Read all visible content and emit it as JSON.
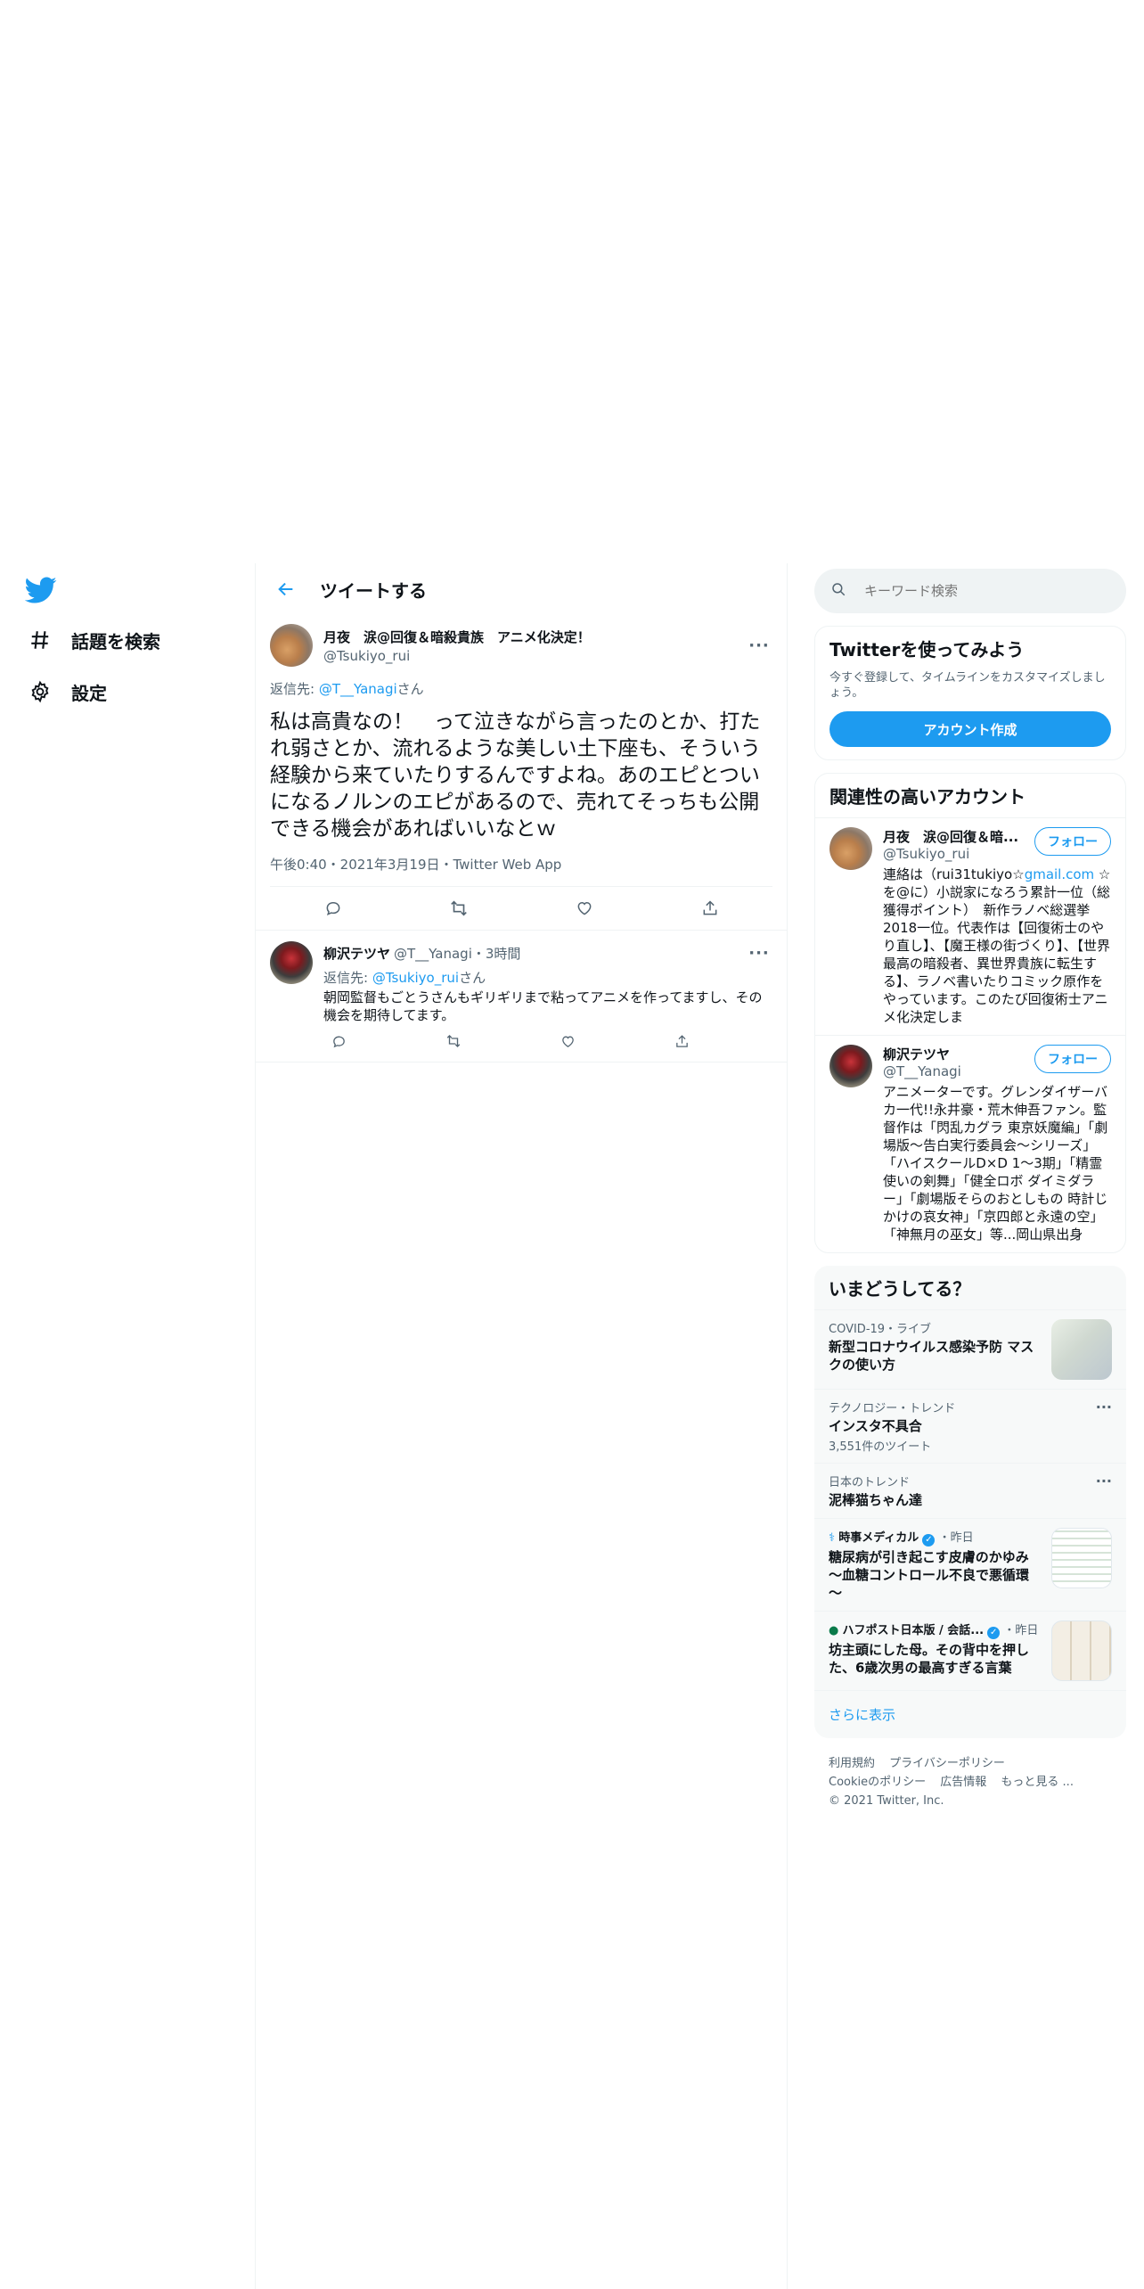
{
  "nav": {
    "logo": "twitter-bird-icon",
    "items": [
      {
        "label": "話題を検索",
        "icon": "hashtag-icon"
      },
      {
        "label": "設定",
        "icon": "gear-icon"
      }
    ]
  },
  "main": {
    "title": "ツイートする",
    "tweet": {
      "name": "月夜　涙@回復＆暗殺貴族　アニメ化決定！",
      "handle": "@Tsukiyo_rui",
      "reply_prefix": "返信先: ",
      "reply_target": "@T__Yanagi",
      "reply_suffix": "さん",
      "text": "私は高貴なの！　って泣きながら言ったのとか、打たれ弱さとか、流れるような美しい土下座も、そういう経験から来ていたりするんですよね。あのエピとついになるノルンのエピがあるので、売れてそっちも公開できる機会があればいいなとｗ",
      "meta": "午後0:40・2021年3月19日・Twitter Web App"
    },
    "reply": {
      "name": "柳沢テツヤ",
      "handle_time": "@T__Yanagi・3時間",
      "reply_prefix": "返信先: ",
      "reply_target": "@Tsukiyo_rui",
      "reply_suffix": "さん",
      "text": "朝岡監督もごとうさんもギリギリまで粘ってアニメを作ってますし、その機会を期待してます。"
    }
  },
  "sidebar": {
    "search_placeholder": "キーワード検索",
    "signup": {
      "title": "Twitterを使ってみよう",
      "desc": "今すぐ登録して、タイムラインをカスタマイズしましょう。",
      "button": "アカウント作成"
    },
    "relevant": {
      "title": "関連性の高いアカウント",
      "follow_label": "フォロー",
      "accounts": [
        {
          "name": "月夜　涙@回復＆暗...",
          "handle": "@Tsukiyo_rui",
          "bio_pre": "連絡は（rui31tukiyo☆",
          "bio_link": "gmail.com",
          "bio_post": " ☆を@に）小説家になろう累計一位（総獲得ポイント）　新作ラノベ総選挙2018一位。代表作は【回復術士のやり直し】、【魔王様の街づくり】、【世界最高の暗殺者、異世界貴族に転生する】、ラノベ書いたりコミック原作をやっています。このたび回復術士アニメ化決定しま"
        },
        {
          "name": "柳沢テツヤ",
          "handle": "@T__Yanagi",
          "bio": "アニメーターです。グレンダイザーバカ一代!!永井豪・荒木伸吾ファン。監督作は「閃乱カグラ 東京妖魔編」「劇場版～告白実行委員会～シリーズ」「ハイスクールD×D 1〜3期」「精霊使いの剣舞」「健全ロボ ダイミダラー」「劇場版そらのおとしもの 時計じかけの哀女神」「京四郎と永遠の空」「神無月の巫女」等...岡山県出身"
        }
      ]
    },
    "trends": {
      "title": "いまどうしてる？",
      "items": [
        {
          "context": "COVID-19・ライブ",
          "title": "新型コロナウイルス感染予防 マスクの使い方",
          "count": ""
        },
        {
          "context": "テクノロジー・トレンド",
          "title": "インスタ不具合",
          "count": "3,551件のツイート"
        },
        {
          "context": "日本のトレンド",
          "title": "泥棒猫ちゃん達",
          "count": ""
        },
        {
          "source": "時事メディカル",
          "time": "・昨日",
          "title": "糖尿病が引き起こす皮膚のかゆみ～血糖コントロール不良で悪循環～"
        },
        {
          "source": "ハフポスト日本版 / 会話...",
          "time": "・昨日",
          "title": "坊主頭にした母。その背中を押した、6歳次男の最高すぎる言葉"
        }
      ],
      "show_more": "さらに表示"
    },
    "footer": {
      "links": [
        "利用規約",
        "プライバシーポリシー",
        "Cookieのポリシー",
        "広告情報",
        "もっと見る ..."
      ],
      "copyright": "© 2021 Twitter, Inc."
    }
  },
  "colors": {
    "accent": "#1d9bf0",
    "text": "#0f1419",
    "muted": "#536471",
    "border": "#eff3f4"
  }
}
